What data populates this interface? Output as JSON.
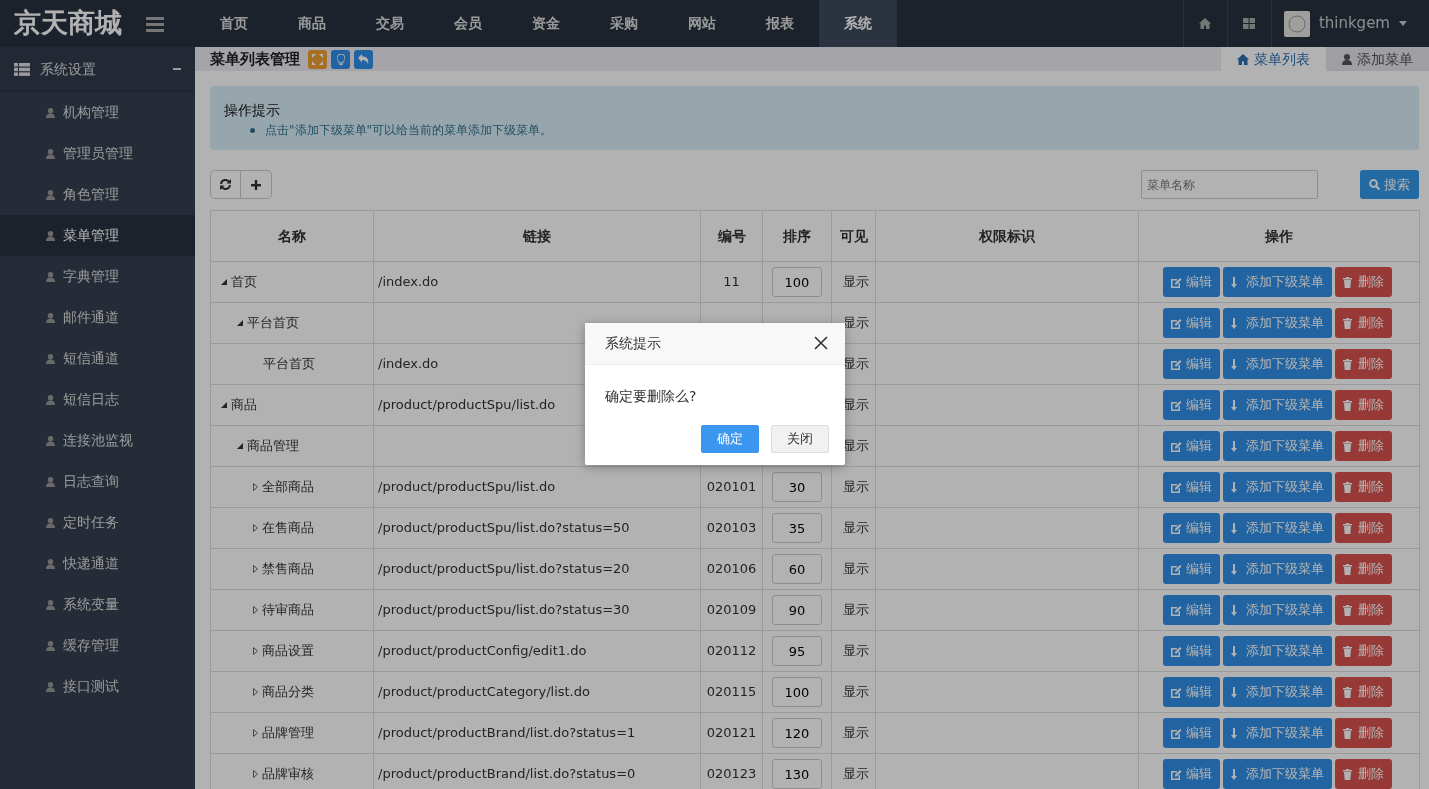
{
  "brand": "京天商城",
  "top_nav": [
    {
      "label": "首页",
      "selected": false
    },
    {
      "label": "商品",
      "selected": false
    },
    {
      "label": "交易",
      "selected": false
    },
    {
      "label": "会员",
      "selected": false
    },
    {
      "label": "资金",
      "selected": false
    },
    {
      "label": "采购",
      "selected": false
    },
    {
      "label": "网站",
      "selected": false
    },
    {
      "label": "报表",
      "selected": false
    },
    {
      "label": "系统",
      "selected": true
    }
  ],
  "user": {
    "name": "thinkgem"
  },
  "sidebar": {
    "group": {
      "label": "系统设置",
      "expanded": true
    },
    "items": [
      {
        "label": "机构管理",
        "selected": false
      },
      {
        "label": "管理员管理",
        "selected": false
      },
      {
        "label": "角色管理",
        "selected": false
      },
      {
        "label": "菜单管理",
        "selected": true
      },
      {
        "label": "字典管理",
        "selected": false
      },
      {
        "label": "邮件通道",
        "selected": false
      },
      {
        "label": "短信通道",
        "selected": false
      },
      {
        "label": "短信日志",
        "selected": false
      },
      {
        "label": "连接池监视",
        "selected": false
      },
      {
        "label": "日志查询",
        "selected": false
      },
      {
        "label": "定时任务",
        "selected": false
      },
      {
        "label": "快递通道",
        "selected": false
      },
      {
        "label": "系统变量",
        "selected": false
      },
      {
        "label": "缓存管理",
        "selected": false
      },
      {
        "label": "接口测试",
        "selected": false
      }
    ]
  },
  "page_title": "菜单列表管理",
  "tabs": [
    {
      "label": "菜单列表",
      "selected": true
    },
    {
      "label": "添加菜单",
      "selected": false
    }
  ],
  "tip": {
    "title": "操作提示",
    "items": [
      "点击\"添加下级菜单\"可以给当前的菜单添加下级菜单。"
    ]
  },
  "search": {
    "placeholder": "菜单名称",
    "button": "搜索"
  },
  "table": {
    "columns": [
      "名称",
      "链接",
      "编号",
      "排序",
      "可见",
      "权限标识",
      "操作"
    ],
    "rows": [
      {
        "name": "首页",
        "link": "/index.do",
        "code": "11",
        "sort": "100",
        "visible": "显示",
        "expanded": true,
        "actions": [
          {
            "kind": "edit",
            "label": "编辑"
          },
          {
            "kind": "add",
            "label": "添加下级菜单"
          },
          {
            "kind": "delete",
            "label": "删除"
          }
        ],
        "children": [
          {
            "name": "平台首页",
            "visible": "显示",
            "expanded": true,
            "actions": [
              {
                "kind": "edit",
                "label": "编辑"
              },
              {
                "kind": "add",
                "label": "添加下级菜单"
              },
              {
                "kind": "delete",
                "label": "删除"
              }
            ],
            "children": [
              {
                "name": "平台首页",
                "link": "/index.do",
                "visible": "显示",
                "actions": [
                  {
                    "kind": "edit",
                    "label": "编辑"
                  },
                  {
                    "kind": "add",
                    "label": "添加下级菜单"
                  },
                  {
                    "kind": "delete",
                    "label": "删除"
                  }
                ]
              }
            ]
          }
        ]
      },
      {
        "name": "商品",
        "link": "/product/productSpu/list.do",
        "visible": "显示",
        "expanded": true,
        "actions": [
          {
            "kind": "edit",
            "label": "编辑"
          },
          {
            "kind": "add",
            "label": "添加下级菜单"
          },
          {
            "kind": "delete",
            "label": "删除"
          }
        ],
        "children": [
          {
            "name": "商品管理",
            "visible": "显示",
            "expanded": true,
            "actions": [
              {
                "kind": "edit",
                "label": "编辑"
              },
              {
                "kind": "add",
                "label": "添加下级菜单"
              },
              {
                "kind": "delete",
                "label": "删除"
              }
            ],
            "children": [
              {
                "name": "全部商品",
                "link": "/product/productSpu/list.do",
                "code": "020101",
                "sort": "30",
                "visible": "显示",
                "expanded": false,
                "actions": [
                  {
                    "kind": "edit",
                    "label": "编辑"
                  },
                  {
                    "kind": "add",
                    "label": "添加下级菜单"
                  },
                  {
                    "kind": "delete",
                    "label": "删除"
                  }
                ]
              },
              {
                "name": "在售商品",
                "link": "/product/productSpu/list.do?status=50",
                "code": "020103",
                "sort": "35",
                "visible": "显示",
                "expanded": false,
                "actions": [
                  {
                    "kind": "edit",
                    "label": "编辑"
                  },
                  {
                    "kind": "add",
                    "label": "添加下级菜单"
                  },
                  {
                    "kind": "delete",
                    "label": "删除"
                  }
                ]
              },
              {
                "name": "禁售商品",
                "link": "/product/productSpu/list.do?status=20",
                "code": "020106",
                "sort": "60",
                "visible": "显示",
                "expanded": false,
                "actions": [
                  {
                    "kind": "edit",
                    "label": "编辑"
                  },
                  {
                    "kind": "add",
                    "label": "添加下级菜单"
                  },
                  {
                    "kind": "delete",
                    "label": "删除"
                  }
                ]
              },
              {
                "name": "待审商品",
                "link": "/product/productSpu/list.do?status=30",
                "code": "020109",
                "sort": "90",
                "visible": "显示",
                "expanded": false,
                "actions": [
                  {
                    "kind": "edit",
                    "label": "编辑"
                  },
                  {
                    "kind": "add",
                    "label": "添加下级菜单"
                  },
                  {
                    "kind": "delete",
                    "label": "删除"
                  }
                ]
              },
              {
                "name": "商品设置",
                "link": "/product/productConfig/edit1.do",
                "code": "020112",
                "sort": "95",
                "visible": "显示",
                "expanded": false,
                "actions": [
                  {
                    "kind": "edit",
                    "label": "编辑"
                  },
                  {
                    "kind": "add",
                    "label": "添加下级菜单"
                  },
                  {
                    "kind": "delete",
                    "label": "删除"
                  }
                ]
              },
              {
                "name": "商品分类",
                "link": "/product/productCategory/list.do",
                "code": "020115",
                "sort": "100",
                "visible": "显示",
                "expanded": false,
                "actions": [
                  {
                    "kind": "edit",
                    "label": "编辑"
                  },
                  {
                    "kind": "add",
                    "label": "添加下级菜单"
                  },
                  {
                    "kind": "delete",
                    "label": "删除"
                  }
                ]
              },
              {
                "name": "品牌管理",
                "link": "/product/productBrand/list.do?status=1",
                "code": "020121",
                "sort": "120",
                "visible": "显示",
                "expanded": false,
                "actions": [
                  {
                    "kind": "edit",
                    "label": "编辑"
                  },
                  {
                    "kind": "add",
                    "label": "添加下级菜单"
                  },
                  {
                    "kind": "delete",
                    "label": "删除"
                  }
                ]
              },
              {
                "name": "品牌审核",
                "link": "/product/productBrand/list.do?status=0",
                "code": "020123",
                "sort": "130",
                "visible": "显示",
                "expanded": false,
                "actions": [
                  {
                    "kind": "edit",
                    "label": "编辑"
                  },
                  {
                    "kind": "add",
                    "label": "添加下级菜单"
                  },
                  {
                    "kind": "delete",
                    "label": "删除"
                  }
                ]
              }
            ]
          }
        ]
      }
    ]
  },
  "dialog": {
    "title": "系统提示",
    "message": "确定要删除么?",
    "buttons": [
      {
        "kind": "primary",
        "label": "确定"
      },
      {
        "kind": "secondary",
        "label": "关闭"
      }
    ]
  }
}
